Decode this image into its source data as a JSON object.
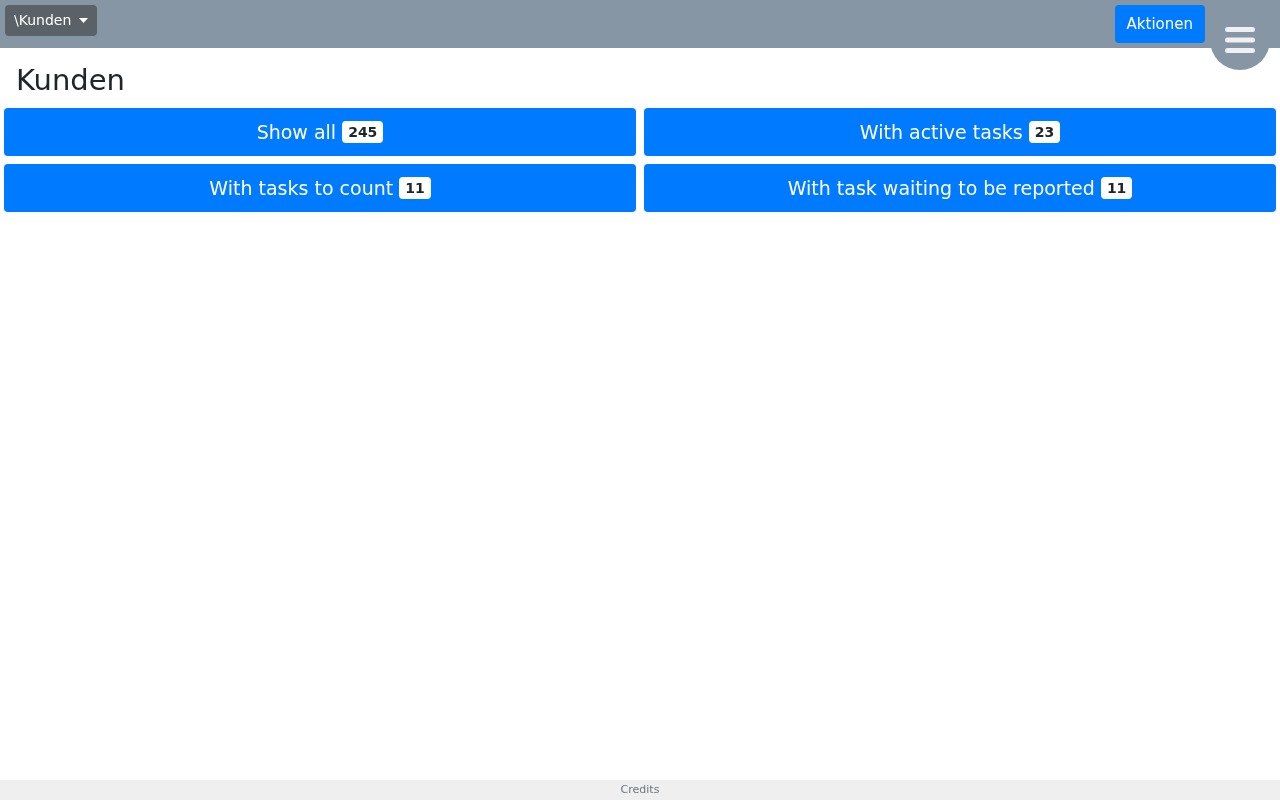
{
  "navbar": {
    "breadcrumb": "\\Kunden",
    "actions_button": "Aktionen"
  },
  "title": "Kunden",
  "filters": [
    {
      "label": "Show all",
      "count": "245"
    },
    {
      "label": "With active tasks",
      "count": "23"
    },
    {
      "label": "With tasks to count",
      "count": "11"
    },
    {
      "label": "With task waiting to be reported",
      "count": "11"
    }
  ],
  "footer": {
    "link": "Credits"
  }
}
